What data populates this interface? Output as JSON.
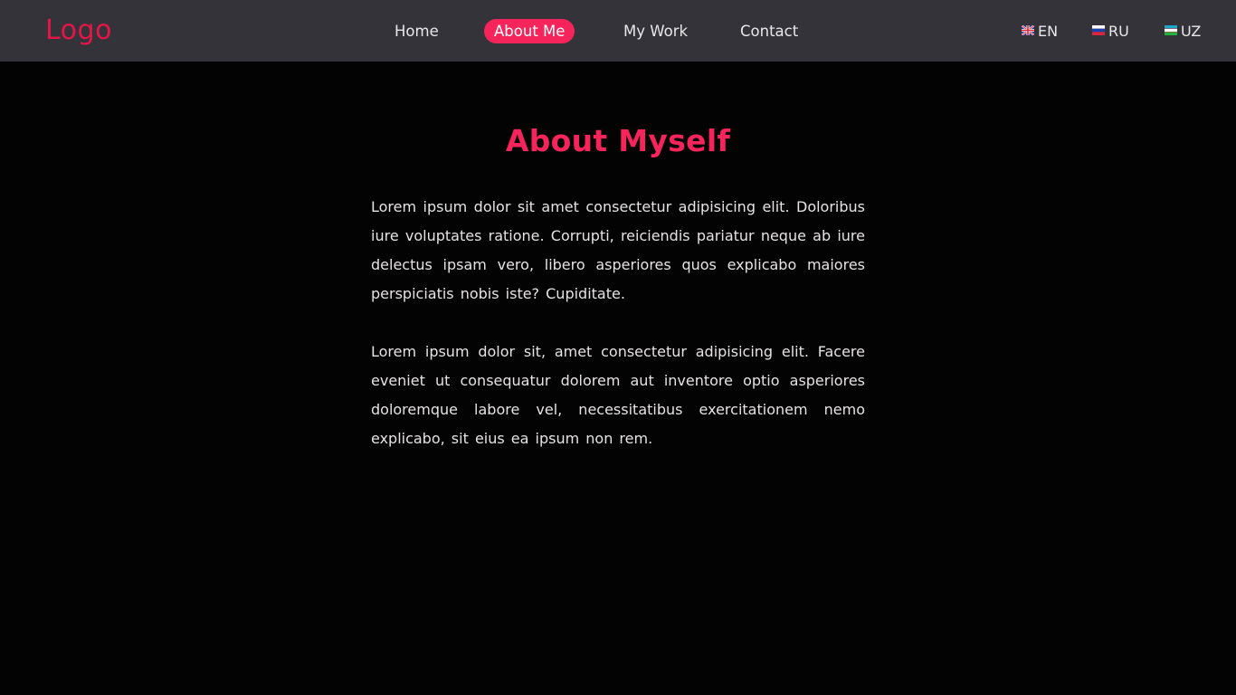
{
  "header": {
    "logo": "Logo",
    "nav": [
      {
        "label": "Home",
        "active": false
      },
      {
        "label": "About Me",
        "active": true
      },
      {
        "label": "My Work",
        "active": false
      },
      {
        "label": "Contact",
        "active": false
      }
    ],
    "languages": [
      {
        "code": "EN",
        "flag": "uk-flag-icon"
      },
      {
        "code": "RU",
        "flag": "russia-flag-icon"
      },
      {
        "code": "UZ",
        "flag": "uzbekistan-flag-icon"
      }
    ]
  },
  "main": {
    "title": "About Myself",
    "paragraphs": [
      "Lorem ipsum dolor sit amet consectetur adipisicing elit. Doloribus iure voluptates ratione. Corrupti, reiciendis pariatur neque ab iure delectus ipsam vero, libero asperiores quos explicabo maiores perspiciatis nobis iste? Cupiditate.",
      "Lorem ipsum dolor sit, amet consectetur adipisicing elit. Facere eveniet ut consequatur dolorem aut inventore optio asperiores doloremque labore vel, necessitatibus exercitationem nemo explicabo, sit eius ea ipsum non rem."
    ]
  },
  "colors": {
    "accent": "#f5245b",
    "logo": "#e21648",
    "navbar_bg": "#34333a",
    "page_bg": "#040303",
    "text": "#e6e3e3"
  }
}
